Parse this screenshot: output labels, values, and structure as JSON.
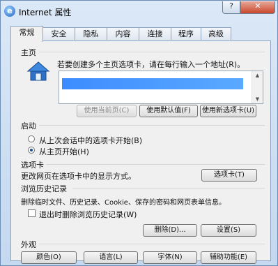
{
  "window": {
    "title": "Internet 属性",
    "help_label": "?",
    "close_label": "✕"
  },
  "tabs": [
    "常规",
    "安全",
    "隐私",
    "内容",
    "连接",
    "程序",
    "高级"
  ],
  "active_tab": "常规",
  "homepage": {
    "section_label": "主页",
    "prompt": "若要创建多个主页选项卡，请在每行输入一个地址(R)。",
    "url_value": "",
    "buttons": {
      "use_current": "使用当前页(C)",
      "use_default": "使用默认值(F)",
      "use_new_tab": "使用新选项卡(U)"
    },
    "icon": "home-icon"
  },
  "startup": {
    "section_label": "启动",
    "options": [
      {
        "label": "从上次会话中的选项卡开始(B)",
        "selected": false
      },
      {
        "label": "从主页开始(H)",
        "selected": true
      }
    ]
  },
  "tabs_section": {
    "section_label": "选项卡",
    "description": "更改网页在选项卡中的显示方式。",
    "button": "选项卡(T)"
  },
  "history": {
    "section_label": "浏览历史记录",
    "description": "删除临时文件、历史记录、Cookie、保存的密码和网页表单信息。",
    "checkbox_label": "退出时删除浏览历史记录(W)",
    "checkbox_checked": false,
    "delete_button": "删除(D)...",
    "settings_button": "设置(S)"
  },
  "appearance": {
    "section_label": "外观",
    "buttons": [
      "颜色(O)",
      "语言(L)",
      "字体(N)",
      "辅助功能(E)"
    ]
  }
}
